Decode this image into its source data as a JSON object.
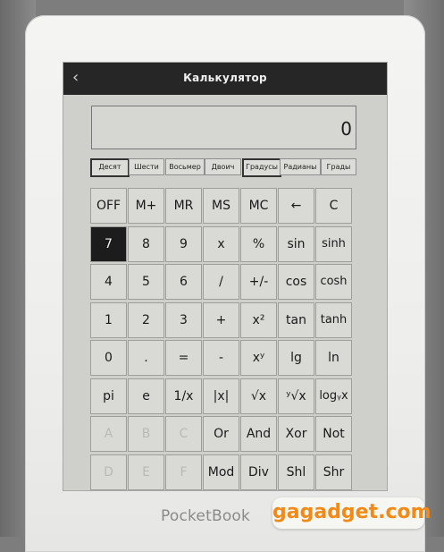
{
  "app": {
    "title": "Калькулятор",
    "back_icon": "chevron-left-icon"
  },
  "display": {
    "value": "0"
  },
  "modes": [
    {
      "label": "Десят",
      "active": true
    },
    {
      "label": "Шести",
      "active": false
    },
    {
      "label": "Восьмер",
      "active": false
    },
    {
      "label": "Двоич",
      "active": false
    },
    {
      "label": "Градусы",
      "active": true
    },
    {
      "label": "Радианы",
      "active": false
    },
    {
      "label": "Грады",
      "active": false
    }
  ],
  "keys": [
    [
      "OFF",
      "M+",
      "MR",
      "MS",
      "MC",
      "←",
      "C"
    ],
    [
      "7",
      "8",
      "9",
      "x",
      "%",
      "sin",
      "sinh"
    ],
    [
      "4",
      "5",
      "6",
      "/",
      "+/-",
      "cos",
      "cosh"
    ],
    [
      "1",
      "2",
      "3",
      "+",
      "x²",
      "tan",
      "tanh"
    ],
    [
      "0",
      ".",
      "=",
      "-",
      "xʸ",
      "lg",
      "ln"
    ],
    [
      "pi",
      "e",
      "1/x",
      "|x|",
      "√x",
      "ʸ√x",
      "logᵧx"
    ],
    [
      "A",
      "B",
      "C",
      "Or",
      "And",
      "Xor",
      "Not"
    ],
    [
      "D",
      "E",
      "F",
      "Mod",
      "Div",
      "Shl",
      "Shr"
    ]
  ],
  "active_key": "7",
  "disabled_keys": [
    "A",
    "B",
    "C",
    "D",
    "E",
    "F"
  ],
  "device": {
    "brand": "PocketBook"
  },
  "watermark": {
    "text": "gagadget.com",
    "color": "#f18a16"
  }
}
